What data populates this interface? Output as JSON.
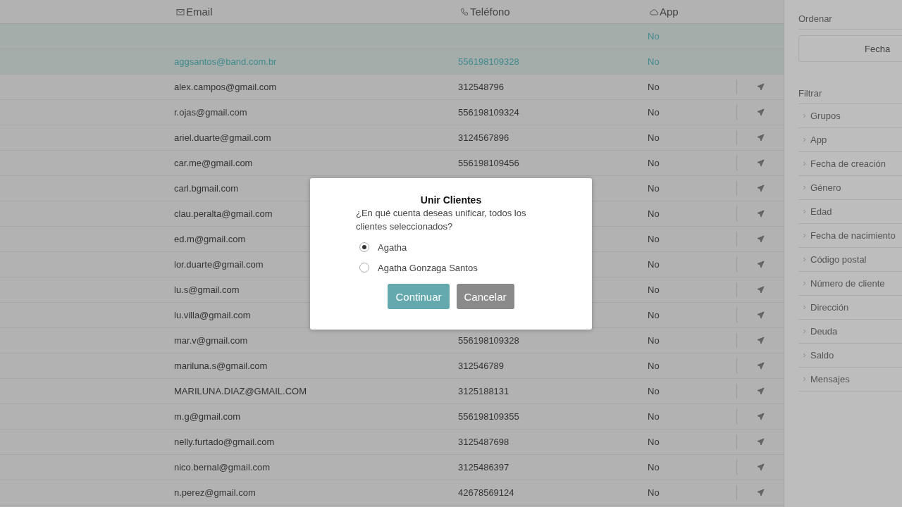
{
  "table": {
    "columns": [
      {
        "label": "Email",
        "kind": "mail"
      },
      {
        "label": "Teléfono",
        "kind": "phone"
      },
      {
        "label": "App",
        "kind": "cloud"
      }
    ],
    "rows": [
      {
        "selected": true,
        "app": "No"
      },
      {
        "selected": true,
        "email": "aggsantos@band.com.br",
        "phone": "556198109328",
        "app": "No"
      },
      {
        "selected": false,
        "email": "alex.campos@gmail.com",
        "phone": "312548796",
        "app": "No"
      },
      {
        "selected": false,
        "email": "r.ojas@gmail.com",
        "phone": "556198109324",
        "app": "No"
      },
      {
        "selected": false,
        "email": "ariel.duarte@gmail.com",
        "phone": "3124567896",
        "app": "No"
      },
      {
        "selected": false,
        "email": "car.me@gmail.com",
        "phone": "556198109456",
        "app": "No"
      },
      {
        "selected": false,
        "email": "carl.bgmail.com",
        "app": "No"
      },
      {
        "selected": false,
        "email": "clau.peralta@gmail.com",
        "app": "No"
      },
      {
        "selected": false,
        "email": "ed.m@gmail.com",
        "app": "No"
      },
      {
        "selected": false,
        "email": "lor.duarte@gmail.com",
        "app": "No"
      },
      {
        "selected": false,
        "email": "lu.s@gmail.com",
        "app": "No"
      },
      {
        "selected": false,
        "email": "lu.villa@gmail.com",
        "app": "No"
      },
      {
        "selected": false,
        "email": "mar.v@gmail.com",
        "phone": "556198109328",
        "app": "No"
      },
      {
        "selected": false,
        "email": "mariluna.s@gmail.com",
        "phone": "312546789",
        "app": "No"
      },
      {
        "selected": false,
        "email": "MARILUNA.DIAZ@GMAIL.COM",
        "phone": "3125188131",
        "app": "No"
      },
      {
        "selected": false,
        "email": "m.g@gmail.com",
        "phone": "556198109355",
        "app": "No"
      },
      {
        "selected": false,
        "email": "nelly.furtado@gmail.com",
        "phone": "3125487698",
        "app": "No"
      },
      {
        "selected": false,
        "email": "nico.bernal@gmail.com",
        "phone": "3125486397",
        "app": "No"
      },
      {
        "selected": false,
        "email": "n.perez@gmail.com",
        "phone": "42678569124",
        "app": "No"
      }
    ]
  },
  "sidebar": {
    "sort_title": "Ordenar",
    "sort_value": "Fecha",
    "filter_title": "Filtrar",
    "filters": [
      "Grupos",
      "App",
      "Fecha de creación",
      "Género",
      "Edad",
      "Fecha de nacimiento",
      "Código postal",
      "Número de cliente",
      "Dirección",
      "Deuda",
      "Saldo",
      "Mensajes"
    ]
  },
  "dialog": {
    "title": "Unir Clientes",
    "message": "¿En qué cuenta deseas unificar, todos los clientes seleccionados?",
    "options": [
      {
        "label": "Agatha",
        "selected": true
      },
      {
        "label": "Agatha Gonzaga Santos",
        "selected": false
      }
    ],
    "buttons": [
      {
        "label": "Continuar",
        "kind": "primary"
      },
      {
        "label": "Cancelar",
        "kind": "secondary"
      }
    ]
  }
}
